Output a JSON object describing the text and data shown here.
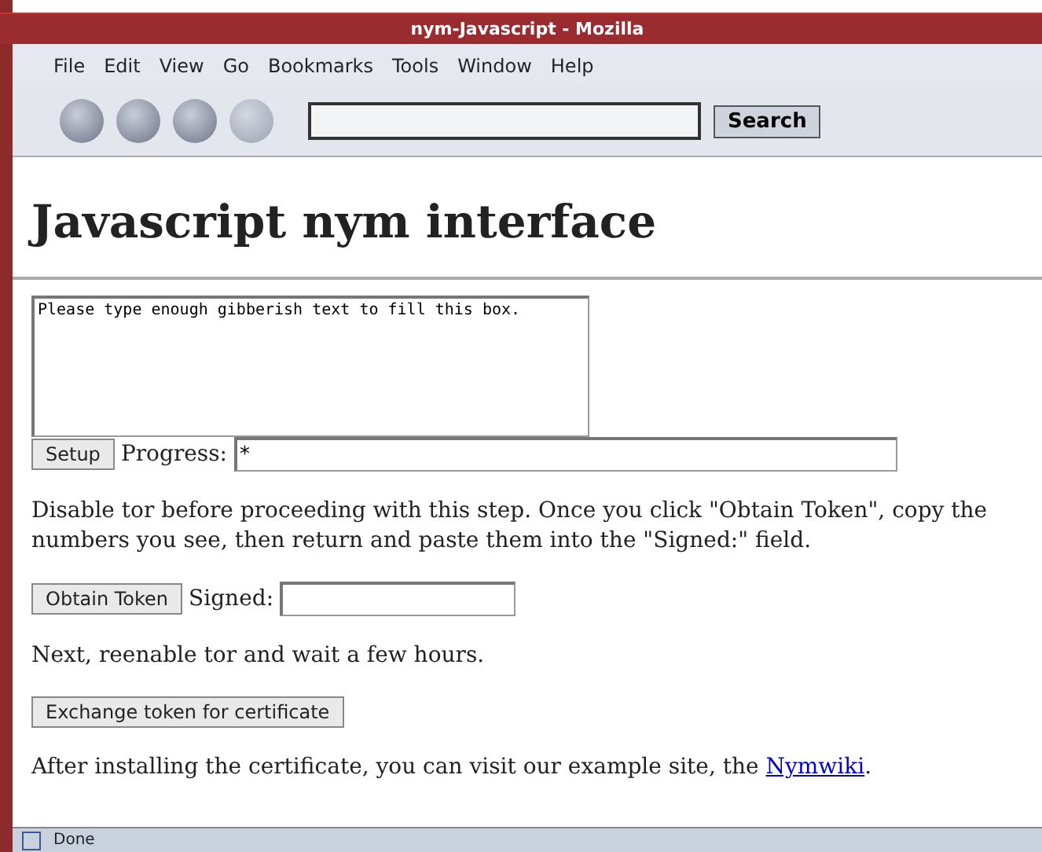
{
  "window": {
    "title": "nym-Javascript - Mozilla"
  },
  "menu": [
    "File",
    "Edit",
    "View",
    "Go",
    "Bookmarks",
    "Tools",
    "Window",
    "Help"
  ],
  "toolbar": {
    "search_button": "Search"
  },
  "page": {
    "heading": "Javascript nym interface",
    "gibberish": "Please type enough gibberish text to fill this box.",
    "setup_button": "Setup",
    "progress_label": "Progress:",
    "progress_value": "*",
    "instructions": "Disable tor before proceeding with this step. Once you click \"Obtain Token\", copy the numbers you see, then return and paste them into the \"Signed:\" field.",
    "obtain_button": "Obtain Token",
    "signed_label": "Signed:",
    "wait_text": "Next, reenable tor and wait a few hours.",
    "exchange_button": "Exchange token for certificate",
    "final_text": "After installing the certificate, you can visit our example site, the ",
    "final_link": "Nymwiki",
    "final_end": "."
  },
  "status_bar": {
    "text": "Done"
  }
}
